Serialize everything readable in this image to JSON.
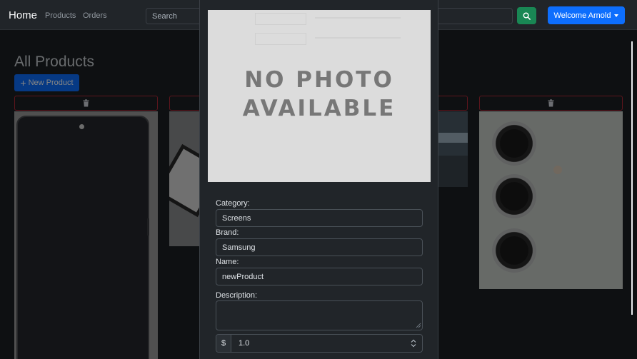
{
  "navbar": {
    "brand": "Home",
    "links": [
      "Products",
      "Orders"
    ],
    "search_placeholder": "Search",
    "search_icon": "magnifier-icon",
    "welcome_label": "Welcome Arnold"
  },
  "page": {
    "title": "All Products",
    "new_product_label": "New Product",
    "delete_icon": "trash-icon"
  },
  "modal": {
    "photo_placeholder": [
      "NO PHOTO",
      "AVAILABLE"
    ],
    "category_label": "Category:",
    "category_value": "Screens",
    "brand_label": "Brand:",
    "brand_value": "Samsung",
    "name_label": "Name:",
    "name_value": "newProduct",
    "description_label": "Description:",
    "description_value": "",
    "currency_symbol": "$",
    "price_value": "1.0"
  },
  "colors": {
    "primary": "#0d6efd",
    "success": "#198754",
    "danger": "#b02a37",
    "background": "#1c1f23"
  }
}
